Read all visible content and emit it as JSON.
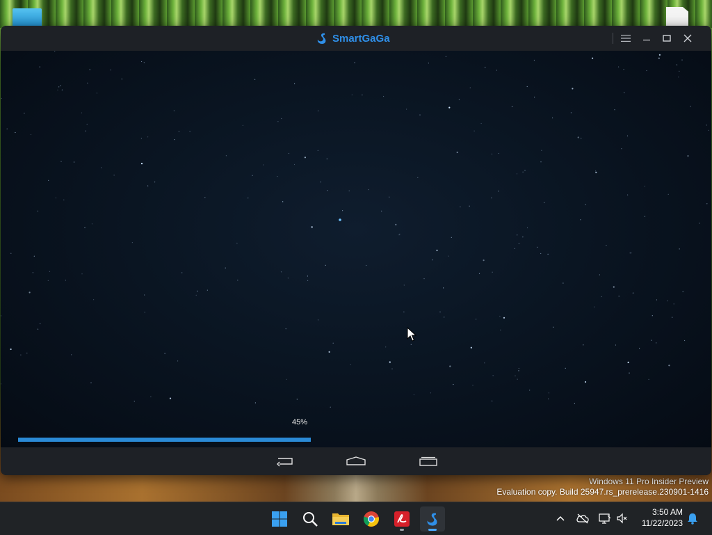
{
  "window": {
    "title": "SmartGaGa",
    "brand_color": "#2f8fe8",
    "controls": {
      "menu_icon": "hamburger-menu-icon",
      "minimize_icon": "minimize-icon",
      "maximize_icon": "maximize-icon",
      "close_icon": "close-icon"
    }
  },
  "screen": {
    "background": "starfield",
    "progress": {
      "label": "45%",
      "value": 0.45,
      "color": "#2a8ad6"
    }
  },
  "navbar": {
    "buttons": [
      "back-icon",
      "home-icon",
      "recent-apps-icon"
    ]
  },
  "watermark": {
    "line1": "Windows 11 Pro Insider Preview",
    "line2": "Evaluation copy. Build 25947.rs_prerelease.230901-1416"
  },
  "taskbar": {
    "apps": [
      "windows-start-icon",
      "search-icon",
      "file-explorer-icon",
      "chrome-icon",
      "pdf-reader-icon",
      "smartgaga-icon"
    ],
    "tray": [
      "chevron-up-icon",
      "cloud-offline-icon",
      "network-icon",
      "volume-muted-icon",
      "notification-bell-icon"
    ],
    "clock": {
      "time": "3:50 AM",
      "date": "11/22/2023"
    }
  }
}
